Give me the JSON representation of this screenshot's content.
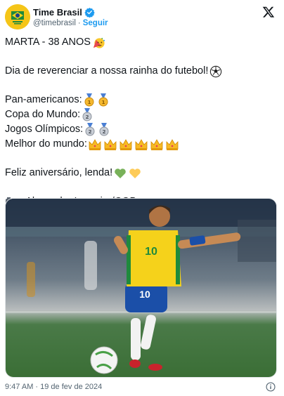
{
  "account": {
    "display_name": "Time Brasil",
    "handle": "@timebrasil",
    "separator": "·",
    "follow_label": "Seguir"
  },
  "tweet": {
    "line1": "MARTA - 38 ANOS",
    "line2": "Dia de reverenciar a nossa rainha do futebol!",
    "line3": "Pan-americanos:",
    "line4": "Copa do Mundo:",
    "line5": "Jogos Olímpicos:",
    "line6": "Melhor do mundo:",
    "line7": "Feliz aniversário, lenda!",
    "line8": ": Alexandre Loureiro/COB",
    "jersey_number": "10",
    "counts": {
      "gold_medals": 2,
      "silver_medals_copa": 1,
      "silver_medals_olympics": 2,
      "crowns": 6
    }
  },
  "footer": {
    "timestamp": "9:47 AM · 19 de fev de 2024"
  },
  "icons": {
    "avatar": "time-brasil-logo",
    "verified": "verified-badge-icon",
    "close": "x-logo-icon",
    "info": "info-icon"
  },
  "colors": {
    "accent": "#1d9bf0",
    "jersey_yellow": "#f5d21b",
    "shorts_blue": "#1b4fa8",
    "grass": "#3f7a3a"
  }
}
